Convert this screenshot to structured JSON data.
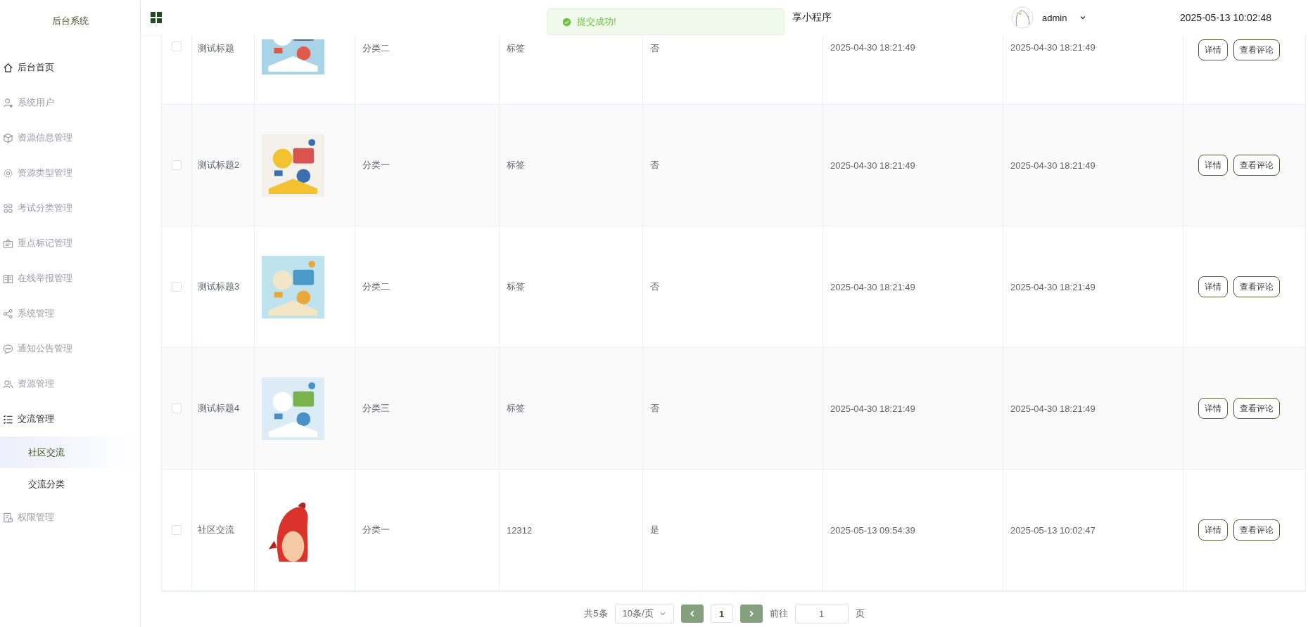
{
  "sidebar": {
    "title": "后台系统",
    "items": [
      {
        "label": "后台首页",
        "highlighted": true
      },
      {
        "label": "系统用户",
        "highlighted": false
      },
      {
        "label": "资源信息管理",
        "highlighted": false
      },
      {
        "label": "资源类型管理",
        "highlighted": false
      },
      {
        "label": "考试分类管理",
        "highlighted": false
      },
      {
        "label": "重点标记管理",
        "highlighted": false
      },
      {
        "label": "在线举报管理",
        "highlighted": false
      },
      {
        "label": "系统管理",
        "highlighted": false
      },
      {
        "label": "通知公告管理",
        "highlighted": false
      },
      {
        "label": "资源管理",
        "highlighted": false
      },
      {
        "label": "交流管理",
        "highlighted": true,
        "expanded": true,
        "children": [
          {
            "label": "社区交流",
            "selected": true
          },
          {
            "label": "交流分类",
            "selected": false
          }
        ]
      },
      {
        "label": "权限管理",
        "highlighted": false
      }
    ]
  },
  "header": {
    "title": "享小程序",
    "user": "admin",
    "time": "2025-05-13 10:02:48"
  },
  "toast": {
    "message": "提交成功!"
  },
  "table": {
    "rows": [
      {
        "checked": false,
        "title": "测试标题",
        "category": "分类二",
        "tags": "标签",
        "flag": "否",
        "created": "2025-04-30 18:21:49",
        "updated": "2025-04-30 18:21:49",
        "actions": [
          "详情",
          "查看评论"
        ]
      },
      {
        "checked": false,
        "title": "测试标题2",
        "category": "分类一",
        "tags": "标签",
        "flag": "否",
        "created": "2025-04-30 18:21:49",
        "updated": "2025-04-30 18:21:49",
        "actions": [
          "详情",
          "查看评论"
        ]
      },
      {
        "checked": false,
        "title": "测试标题3",
        "category": "分类二",
        "tags": "标签",
        "flag": "否",
        "created": "2025-04-30 18:21:49",
        "updated": "2025-04-30 18:21:49",
        "actions": [
          "详情",
          "查看评论"
        ]
      },
      {
        "checked": false,
        "title": "测试标题4",
        "category": "分类三",
        "tags": "标签",
        "flag": "否",
        "created": "2025-04-30 18:21:49",
        "updated": "2025-04-30 18:21:49",
        "actions": [
          "详情",
          "查看评论"
        ]
      },
      {
        "checked": false,
        "title": "社区交流",
        "category": "分类一",
        "tags": "12312",
        "flag": "是",
        "created": "2025-05-13 09:54:39",
        "updated": "2025-05-13 10:02:47",
        "actions": [
          "详情",
          "查看评论"
        ]
      }
    ]
  },
  "pagination": {
    "total": "共5条",
    "page_size": "10条/页",
    "pages": [
      {
        "label": "1",
        "selected": true
      }
    ],
    "goto_label": "前往",
    "goto_value": "1",
    "page_unit": "页"
  }
}
